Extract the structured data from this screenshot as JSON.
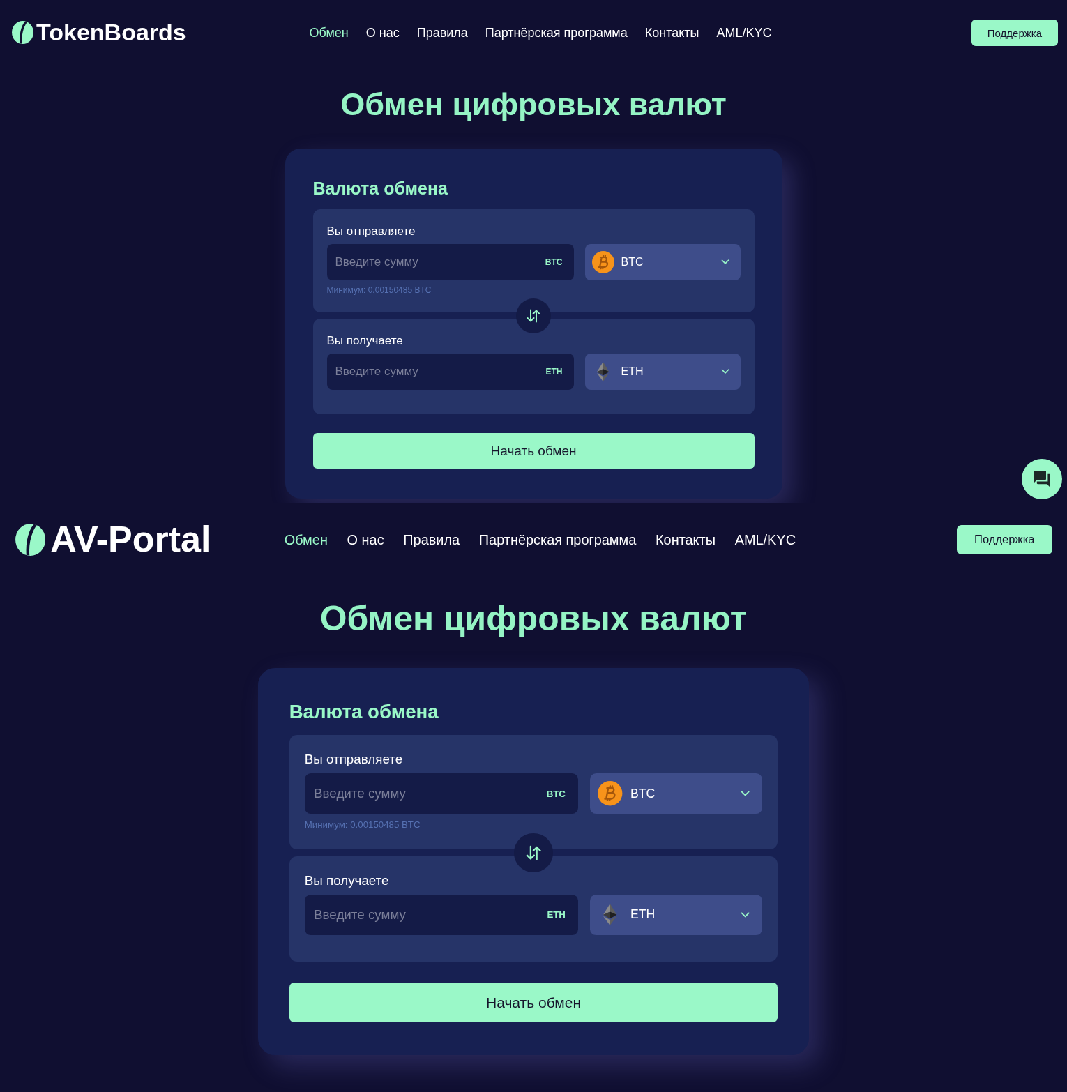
{
  "screens": [
    {
      "brand": "TokenBoards",
      "nav": [
        {
          "label": "Обмен",
          "selected": true
        },
        {
          "label": "О нас",
          "selected": false
        },
        {
          "label": "Правила",
          "selected": false
        },
        {
          "label": "Партнёрская программа",
          "selected": false
        },
        {
          "label": "Контакты",
          "selected": false
        },
        {
          "label": "AML/KYC",
          "selected": false
        }
      ],
      "support_button": "Поддержка",
      "title": "Обмен цифровых валют",
      "exchange": {
        "heading": "Валюта обмена",
        "legs": [
          {
            "label": "Вы отправляете",
            "placeholder": "Введите сумму",
            "unit": "BTC",
            "coin": {
              "kind": "bitcoin",
              "ticker": "BTC"
            },
            "minimum": "Минимум: 0.00150485 BTC"
          },
          {
            "label": "Вы получаете",
            "placeholder": "Введите сумму",
            "unit": "ETH",
            "coin": {
              "kind": "ethereum",
              "ticker": "ETH"
            }
          }
        ],
        "submit": "Начать обмен"
      },
      "chat_button": true
    },
    {
      "brand": "AV-Portal",
      "nav": [
        {
          "label": "Обмен",
          "selected": true
        },
        {
          "label": "О нас",
          "selected": false
        },
        {
          "label": "Правила",
          "selected": false
        },
        {
          "label": "Партнёрская программа",
          "selected": false
        },
        {
          "label": "Контакты",
          "selected": false
        },
        {
          "label": "AML/KYC",
          "selected": false
        }
      ],
      "support_button": "Поддержка",
      "title": "Обмен цифровых валют",
      "exchange": {
        "heading": "Валюта обмена",
        "legs": [
          {
            "label": "Вы отправляете",
            "placeholder": "Введите сумму",
            "unit": "BTC",
            "coin": {
              "kind": "bitcoin",
              "ticker": "BTC"
            },
            "minimum": "Минимум: 0.00150485 BTC"
          },
          {
            "label": "Вы получаете",
            "placeholder": "Введите сумму",
            "unit": "ETH",
            "coin": {
              "kind": "ethereum",
              "ticker": "ETH"
            }
          }
        ],
        "submit": "Начать обмен"
      }
    }
  ]
}
